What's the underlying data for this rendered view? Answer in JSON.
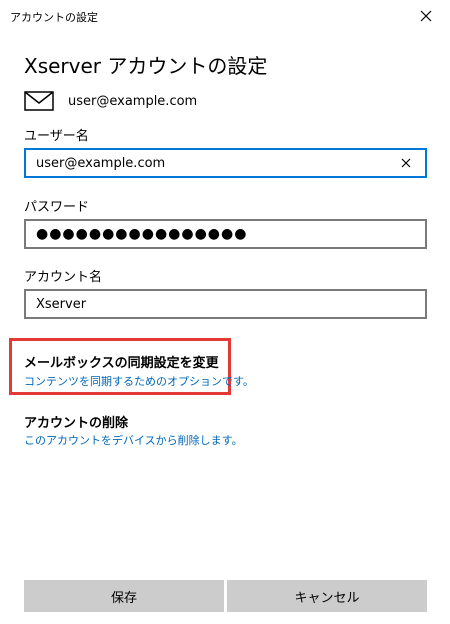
{
  "window": {
    "title": "アカウントの設定"
  },
  "heading": "Xserver アカウントの設定",
  "account_email": "user@example.com",
  "username": {
    "label": "ユーザー名",
    "value": "user@example.com"
  },
  "password": {
    "label": "パスワード",
    "masked_value": "●●●●●●●●●●●●●●●●"
  },
  "account_name": {
    "label": "アカウント名",
    "value": "Xserver"
  },
  "sync_settings": {
    "title": "メールボックスの同期設定を変更",
    "subtitle": "コンテンツを同期するためのオプションです。"
  },
  "delete_account": {
    "title": "アカウントの削除",
    "subtitle": "このアカウントをデバイスから削除します。"
  },
  "buttons": {
    "save": "保存",
    "cancel": "キャンセル"
  },
  "colors": {
    "accent": "#0078d7",
    "link": "#0067b8",
    "highlight": "#e53935",
    "button": "#cccccc"
  }
}
